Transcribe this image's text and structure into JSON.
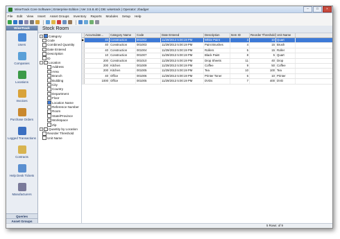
{
  "window": {
    "title": "WiseTrack Core Software | Enterprise Edition | Ver 3.5.8.40 | DB: wisetrack | Operator: zbadger",
    "buttons": {
      "minimize": "–",
      "maximize": "□",
      "close": "×"
    }
  },
  "menu": [
    "File",
    "Edit",
    "View",
    "Insert",
    "Asset Groups",
    "Inventory",
    "Reports",
    "Modules",
    "Setup",
    "Help"
  ],
  "nav": {
    "header": "WiseTrack",
    "items": [
      {
        "label": "Users",
        "icon": "users-icon",
        "color": "#4b8ad6"
      },
      {
        "label": "Companies",
        "icon": "companies-icon",
        "color": "#5aa0d8"
      },
      {
        "label": "Locations",
        "icon": "locations-icon",
        "color": "#3c9a48"
      },
      {
        "label": "Invoices",
        "icon": "invoices-icon",
        "color": "#d9a33a"
      },
      {
        "label": "Purchase Orders",
        "icon": "purchase-orders-icon",
        "color": "#c9882e"
      },
      {
        "label": "Logged Transactions",
        "icon": "transactions-icon",
        "color": "#3b6fc1"
      },
      {
        "label": "Contracts",
        "icon": "contracts-icon",
        "color": "#d8b450"
      },
      {
        "label": "Help Desk Tickets",
        "icon": "help-desk-icon",
        "color": "#5a8fd0"
      },
      {
        "label": "Manufacturers",
        "icon": "manufacturers-icon",
        "color": "#7a7a9a"
      }
    ],
    "footer": [
      "Queries",
      "Asset Groups"
    ]
  },
  "page": {
    "title": "Stock Room"
  },
  "fields": [
    {
      "label": "Category",
      "indent": 0,
      "expander": "+",
      "checked": true
    },
    {
      "label": "Code",
      "indent": 0,
      "expander": "",
      "checked": false
    },
    {
      "label": "Combined Quantity",
      "indent": 0,
      "expander": "",
      "checked": false
    },
    {
      "label": "Date Entered",
      "indent": 0,
      "expander": "",
      "checked": false
    },
    {
      "label": "Description",
      "indent": 0,
      "expander": "",
      "checked": false
    },
    {
      "label": "ID",
      "indent": 0,
      "expander": "",
      "checked": false
    },
    {
      "label": "Location",
      "indent": 0,
      "expander": "−",
      "checked": false
    },
    {
      "label": "Address",
      "indent": 1,
      "expander": "",
      "checked": false
    },
    {
      "label": "Area",
      "indent": 1,
      "expander": "",
      "checked": false
    },
    {
      "label": "Branch",
      "indent": 1,
      "expander": "",
      "checked": false
    },
    {
      "label": "Building",
      "indent": 1,
      "expander": "",
      "checked": false
    },
    {
      "label": "City",
      "indent": 1,
      "expander": "",
      "checked": false
    },
    {
      "label": "Country",
      "indent": 1,
      "expander": "",
      "checked": false
    },
    {
      "label": "Department",
      "indent": 1,
      "expander": "",
      "checked": false
    },
    {
      "label": "Floor",
      "indent": 1,
      "expander": "",
      "checked": false
    },
    {
      "label": "Location Name",
      "indent": 1,
      "expander": "",
      "checked": true
    },
    {
      "label": "Reference Number",
      "indent": 1,
      "expander": "",
      "checked": false
    },
    {
      "label": "Room",
      "indent": 1,
      "expander": "",
      "checked": false
    },
    {
      "label": "State/Province",
      "indent": 1,
      "expander": "",
      "checked": false
    },
    {
      "label": "Workspace",
      "indent": 1,
      "expander": "",
      "checked": false
    },
    {
      "label": "Zip",
      "indent": 1,
      "expander": "",
      "checked": false
    },
    {
      "label": "Quantity by Location",
      "indent": 0,
      "expander": "+",
      "checked": false
    },
    {
      "label": "Reorder Threshold",
      "indent": 0,
      "expander": "",
      "checked": false
    },
    {
      "label": "Unit Name",
      "indent": 0,
      "expander": "",
      "checked": false
    }
  ],
  "grid": {
    "columns": [
      "Accumulate...",
      "Category Name",
      "Code",
      "Date Entered",
      "Description",
      "Item ID",
      "Reorder Threshold",
      "Unit Name"
    ],
    "rows": [
      [
        "40",
        "Construction",
        "001002",
        "11/29/2013 5:00:19 PM",
        "White Paint",
        "3",
        "10",
        "Quart"
      ],
      [
        "40",
        "Construction",
        "001003",
        "11/29/2013 5:00:19 PM",
        "Paint Brushes",
        "4",
        "15",
        "Brush"
      ],
      [
        "40",
        "Construction",
        "001004",
        "11/29/2013 5:00:19 PM",
        "Rollers",
        "5",
        "15",
        "Roller"
      ],
      [
        "10",
        "Construction",
        "001007",
        "11/29/2013 5:00:19 PM",
        "Black Paint",
        "8",
        "5",
        "Quart"
      ],
      [
        "200",
        "Construction",
        "001010",
        "11/29/2013 5:00:19 PM",
        "Drop Sheets",
        "11",
        "40",
        "Drop"
      ],
      [
        "200",
        "Kitchen",
        "001009",
        "11/29/2013 5:00:19 PM",
        "Coffee",
        "9",
        "50",
        "Coffee"
      ],
      [
        "200",
        "Kitchen",
        "001005",
        "11/29/2013 5:00:19 PM",
        "Tea",
        "10",
        "100",
        "Tea"
      ],
      [
        "40",
        "Office",
        "001006",
        "11/29/2013 5:00:19 PM",
        "Printer Toner",
        "6",
        "10",
        "Printer"
      ],
      [
        "1000",
        "Office",
        "001005",
        "11/29/2013 5:00:19 PM",
        "DVDs",
        "7",
        "400",
        "DVD"
      ]
    ],
    "selected_row": 0
  },
  "status": {
    "rows": "5 Rows: of 9"
  }
}
